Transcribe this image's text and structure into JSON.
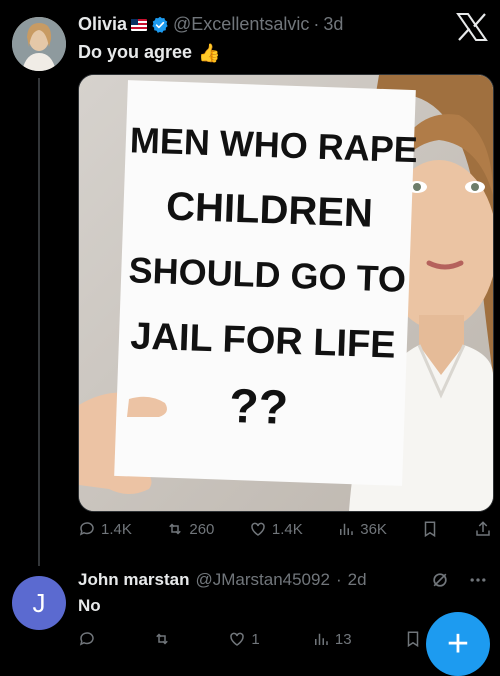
{
  "tweet": {
    "author_name": "Olivia",
    "author_handle": "@Excellentsalvic",
    "time": "3d",
    "text": "Do you agree",
    "emoji": "👍",
    "sign_lines": [
      "MEN WHO RAPE",
      "CHILDREN",
      "SHOULD GO TO",
      "JAIL FOR LIFE",
      "??"
    ],
    "stats": {
      "replies": "1.4K",
      "retweets": "260",
      "likes": "1.4K",
      "views": "36K"
    }
  },
  "reply": {
    "avatar_letter": "J",
    "author_name": "John marstan",
    "author_handle": "@JMarstan45092",
    "time": "2d",
    "text": "No",
    "stats": {
      "replies": "",
      "retweets": "",
      "likes": "1",
      "views": "13"
    }
  },
  "colors": {
    "accent": "#1d9bf0",
    "background": "#000000",
    "secondary_text": "#71767b"
  },
  "icons": [
    "verified-badge-icon",
    "us-flag-icon",
    "x-logo-icon",
    "reply-icon",
    "retweet-icon",
    "like-icon",
    "views-icon",
    "bookmark-icon",
    "share-icon",
    "grok-icon",
    "more-icon",
    "compose-plus-icon"
  ]
}
